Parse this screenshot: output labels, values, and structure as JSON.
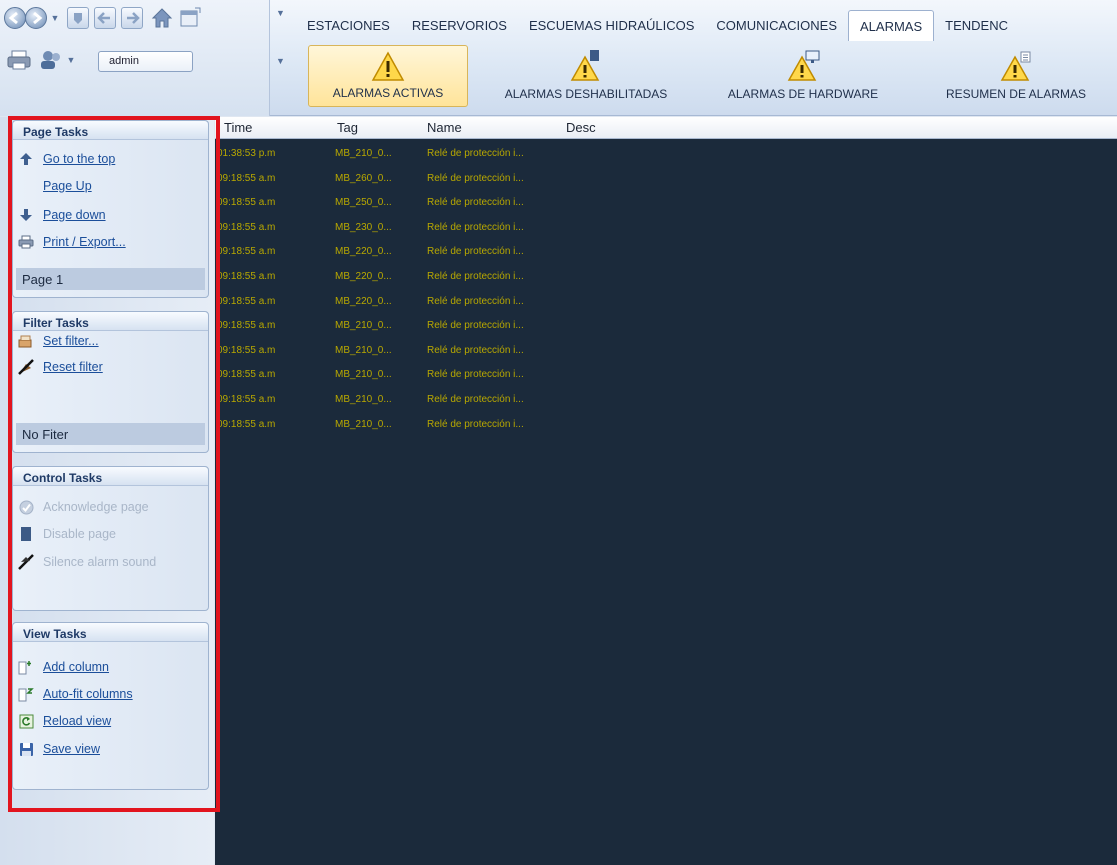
{
  "toolbar": {
    "user": "admin"
  },
  "tabs": [
    {
      "label": "ESTACIONES",
      "active": false
    },
    {
      "label": "RESERVORIOS",
      "active": false
    },
    {
      "label": "ESCUEMAS HIDRAÚLICOS",
      "active": false
    },
    {
      "label": "COMUNICACIONES",
      "active": false
    },
    {
      "label": "ALARMAS",
      "active": true
    },
    {
      "label": "TENDENC",
      "active": false
    }
  ],
  "ribbon": [
    {
      "label": "ALARMAS ACTIVAS",
      "icon": "warning-icon",
      "active": true
    },
    {
      "label": "ALARMAS DESHABILITADAS",
      "icon": "warning-disabled-icon",
      "active": false
    },
    {
      "label": "ALARMAS DE HARDWARE",
      "icon": "warning-hardware-icon",
      "active": false
    },
    {
      "label": "RESUMEN DE ALARMAS",
      "icon": "warning-summary-icon",
      "active": false
    }
  ],
  "page_tasks": {
    "title": "Page Tasks",
    "items": [
      {
        "label": "Go to the top",
        "icon": "arrow-up-icon"
      },
      {
        "label": "Page Up",
        "icon": ""
      },
      {
        "label": "Page down",
        "icon": "arrow-down-icon"
      },
      {
        "label": "Print / Export...",
        "icon": "printer-icon"
      }
    ],
    "status": "Page 1"
  },
  "filter_tasks": {
    "title": "Filter Tasks",
    "items": [
      {
        "label": "Set filter...",
        "icon": "filter-icon"
      },
      {
        "label": "Reset filter",
        "icon": "reset-filter-icon"
      }
    ],
    "status": "No Fiter"
  },
  "control_tasks": {
    "title": "Control Tasks",
    "items": [
      {
        "label": "Acknowledge page",
        "icon": "acknowledge-icon",
        "disabled": true
      },
      {
        "label": "Disable page",
        "icon": "disable-icon",
        "disabled": true
      },
      {
        "label": "Silence alarm sound",
        "icon": "silence-icon",
        "disabled": true
      }
    ]
  },
  "view_tasks": {
    "title": "View Tasks",
    "items": [
      {
        "label": "Add column",
        "icon": "add-column-icon"
      },
      {
        "label": "Auto-fit columns",
        "icon": "autofit-columns-icon"
      },
      {
        "label": "Reload view",
        "icon": "reload-icon"
      },
      {
        "label": "Save view",
        "icon": "save-icon"
      }
    ]
  },
  "grid": {
    "columns": [
      "Time",
      "Tag",
      "Name",
      "Desc"
    ],
    "rows": [
      {
        "time": "01:38:53 p.m",
        "tag": "MB_210_0...",
        "name": "Relé de protección i..."
      },
      {
        "time": "09:18:55 a.m",
        "tag": "MB_260_0...",
        "name": "Relé de protección i..."
      },
      {
        "time": "09:18:55 a.m",
        "tag": "MB_250_0...",
        "name": "Relé de protección i..."
      },
      {
        "time": "09:18:55 a.m",
        "tag": "MB_230_0...",
        "name": "Relé de protección i..."
      },
      {
        "time": "09:18:55 a.m",
        "tag": "MB_220_0...",
        "name": "Relé de protección i..."
      },
      {
        "time": "09:18:55 a.m",
        "tag": "MB_220_0...",
        "name": "Relé de protección i..."
      },
      {
        "time": "09:18:55 a.m",
        "tag": "MB_220_0...",
        "name": "Relé de protección i..."
      },
      {
        "time": "09:18:55 a.m",
        "tag": "MB_210_0...",
        "name": "Relé de protección i..."
      },
      {
        "time": "09:18:55 a.m",
        "tag": "MB_210_0...",
        "name": "Relé de protección i..."
      },
      {
        "time": "09:18:55 a.m",
        "tag": "MB_210_0...",
        "name": "Relé de protección i..."
      },
      {
        "time": "09:18:55 a.m",
        "tag": "MB_210_0...",
        "name": "Relé de protección i..."
      },
      {
        "time": "09:18:55 a.m",
        "tag": "MB_210_0...",
        "name": "Relé de protección i..."
      }
    ]
  },
  "colors": {
    "grid_background": "#1b2a3b",
    "alarm_text": "#b8a800",
    "highlight_outline": "#e2141e",
    "link": "#1b4e9a"
  }
}
